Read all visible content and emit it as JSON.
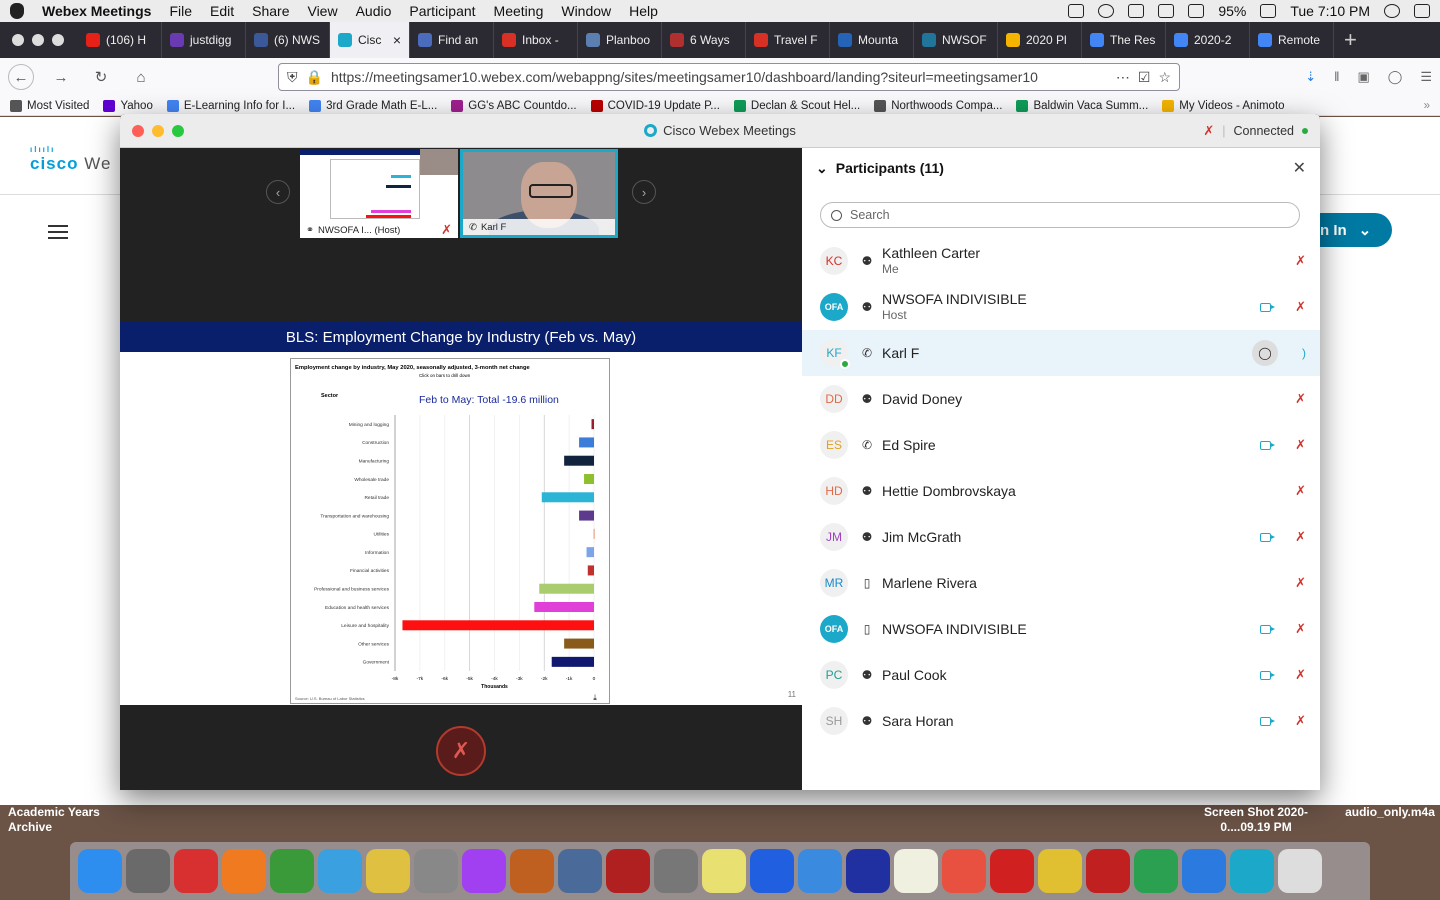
{
  "menubar": {
    "app": "Webex Meetings",
    "items": [
      "File",
      "Edit",
      "Share",
      "View",
      "Audio",
      "Participant",
      "Meeting",
      "Window",
      "Help"
    ],
    "battery": "95%",
    "clock": "Tue 7:10 PM"
  },
  "browser": {
    "tabs": [
      {
        "label": "(106) H",
        "color": "#e62117"
      },
      {
        "label": "justdigg",
        "color": "#6a3ab2"
      },
      {
        "label": "(6) NWS",
        "color": "#3b5998"
      },
      {
        "label": "Cisc",
        "color": "#1ca9c9",
        "active": true
      },
      {
        "label": "Find an",
        "color": "#4b6bbd"
      },
      {
        "label": "Inbox -",
        "color": "#d93025"
      },
      {
        "label": "Planboo",
        "color": "#5b7fb0"
      },
      {
        "label": "6 Ways",
        "color": "#b03030"
      },
      {
        "label": "Travel F",
        "color": "#d93025"
      },
      {
        "label": "Mounta",
        "color": "#2463b5"
      },
      {
        "label": "NWSOF",
        "color": "#21759b"
      },
      {
        "label": "2020 Pl",
        "color": "#f4b400"
      },
      {
        "label": "The Res",
        "color": "#4285f4"
      },
      {
        "label": "2020-2",
        "color": "#4285f4"
      },
      {
        "label": "Remote",
        "color": "#4285f4"
      }
    ],
    "url": "https://meetingsamer10.webex.com/webappng/sites/meetingsamer10/dashboard/landing?siteurl=meetingsamer10",
    "bookmarks": [
      {
        "label": "Most Visited",
        "color": "#555"
      },
      {
        "label": "Yahoo",
        "color": "#5f01d1"
      },
      {
        "label": "E-Learning Info for I...",
        "color": "#4285f4"
      },
      {
        "label": "3rd Grade Math E-L...",
        "color": "#4285f4"
      },
      {
        "label": "GG's ABC Countdo...",
        "color": "#a02090"
      },
      {
        "label": "COVID-19 Update P...",
        "color": "#b00"
      },
      {
        "label": "Declan & Scout Hel...",
        "color": "#0f9d58"
      },
      {
        "label": "Northwoods Compa...",
        "color": "#555"
      },
      {
        "label": "Baldwin Vaca Summ...",
        "color": "#0f9d58"
      },
      {
        "label": "My Videos - Animoto",
        "color": "#f4b400"
      }
    ]
  },
  "page": {
    "logo": "cisco",
    "logo_suffix": "We",
    "signin": "n In"
  },
  "webex": {
    "title": "Cisco Webex Meetings",
    "status": "Connected",
    "thumbs": [
      {
        "name": "NWSOFA I... (Host)"
      },
      {
        "name": "Karl F"
      }
    ],
    "slide_title": "BLS:  Employment Change by Industry (Feb vs. May)",
    "slide_page": "11",
    "panel_title": "Participants (11)",
    "search_placeholder": "Search",
    "participants": [
      {
        "initials": "KC",
        "name": "Kathleen Carter",
        "sub": "Me",
        "audio": "headset",
        "cam": false,
        "mic": true,
        "color": "#d0342c"
      },
      {
        "initials": "OFA",
        "name": "NWSOFA INDIVISIBLE",
        "sub": "Host",
        "audio": "headset",
        "cam": true,
        "mic": true,
        "ofa": true
      },
      {
        "initials": "KF",
        "name": "Karl F",
        "sub": "",
        "audio": "phone",
        "cam": false,
        "mic": false,
        "chat": true,
        "selected": true,
        "color": "#1ca9c9"
      },
      {
        "initials": "DD",
        "name": "David Doney",
        "sub": "",
        "audio": "headset",
        "cam": false,
        "mic": true,
        "color": "#e06a4a"
      },
      {
        "initials": "ES",
        "name": "Ed Spire",
        "sub": "",
        "audio": "phone",
        "cam": true,
        "mic": true,
        "color": "#e0a020"
      },
      {
        "initials": "HD",
        "name": "Hettie Dombrovskaya",
        "sub": "",
        "audio": "headset",
        "cam": false,
        "mic": true,
        "color": "#e06a4a"
      },
      {
        "initials": "JM",
        "name": "Jim McGrath",
        "sub": "",
        "audio": "headset",
        "cam": true,
        "mic": true,
        "color": "#a040c0"
      },
      {
        "initials": "MR",
        "name": "Marlene Rivera",
        "sub": "",
        "audio": "mobile",
        "cam": false,
        "mic": true,
        "color": "#1c8ac9"
      },
      {
        "initials": "OFA",
        "name": "NWSOFA INDIVISIBLE",
        "sub": "",
        "audio": "mobile",
        "cam": true,
        "mic": true,
        "ofa": true
      },
      {
        "initials": "PC",
        "name": "Paul Cook",
        "sub": "",
        "audio": "headset",
        "cam": true,
        "mic": true,
        "color": "#20a090"
      },
      {
        "initials": "SH",
        "name": "Sara Horan",
        "sub": "",
        "audio": "headset",
        "cam": true,
        "mic": true,
        "color": "#999"
      }
    ]
  },
  "chart_data": {
    "type": "bar",
    "orientation": "horizontal",
    "title": "Employment change by industry, May 2020, seasonally adjusted, 3-month net change",
    "subtitle": "Click on bars to drill down",
    "annotation": "Feb to May:  Total -19.6 million",
    "category_axis_label": "Sector",
    "xlabel": "Thousands",
    "xlim": [
      -8000,
      0
    ],
    "ticks": [
      "-8k",
      "-7k",
      "-6k",
      "-5k",
      "-4k",
      "-3k",
      "-2k",
      "-1k",
      "0"
    ],
    "source": "Source: U.S. Bureau of Labor Statistics",
    "categories": [
      "Mining and logging",
      "Construction",
      "Manufacturing",
      "Wholesale trade",
      "Retail trade",
      "Transportation and warehousing",
      "Utilities",
      "Information",
      "Financial activities",
      "Professional and business services",
      "Education and health services",
      "Leisure and hospitality",
      "Other services",
      "Government"
    ],
    "values": [
      -100,
      -600,
      -1200,
      -400,
      -2100,
      -600,
      -20,
      -300,
      -250,
      -2200,
      -2400,
      -7700,
      -1200,
      -1700
    ],
    "colors": [
      "#9b1c2c",
      "#3b7dd8",
      "#12233d",
      "#8dbf2e",
      "#2bb4d6",
      "#5c3a8e",
      "#e8a080",
      "#7da3e8",
      "#c0302c",
      "#a8cc6e",
      "#e040d8",
      "#ff1010",
      "#8a5a1a",
      "#101870"
    ]
  },
  "desktop": {
    "folder": "Academic Years Archive",
    "file1": "Screen Shot 2020-0....09.19 PM",
    "file2": "audio_only.m4a"
  }
}
